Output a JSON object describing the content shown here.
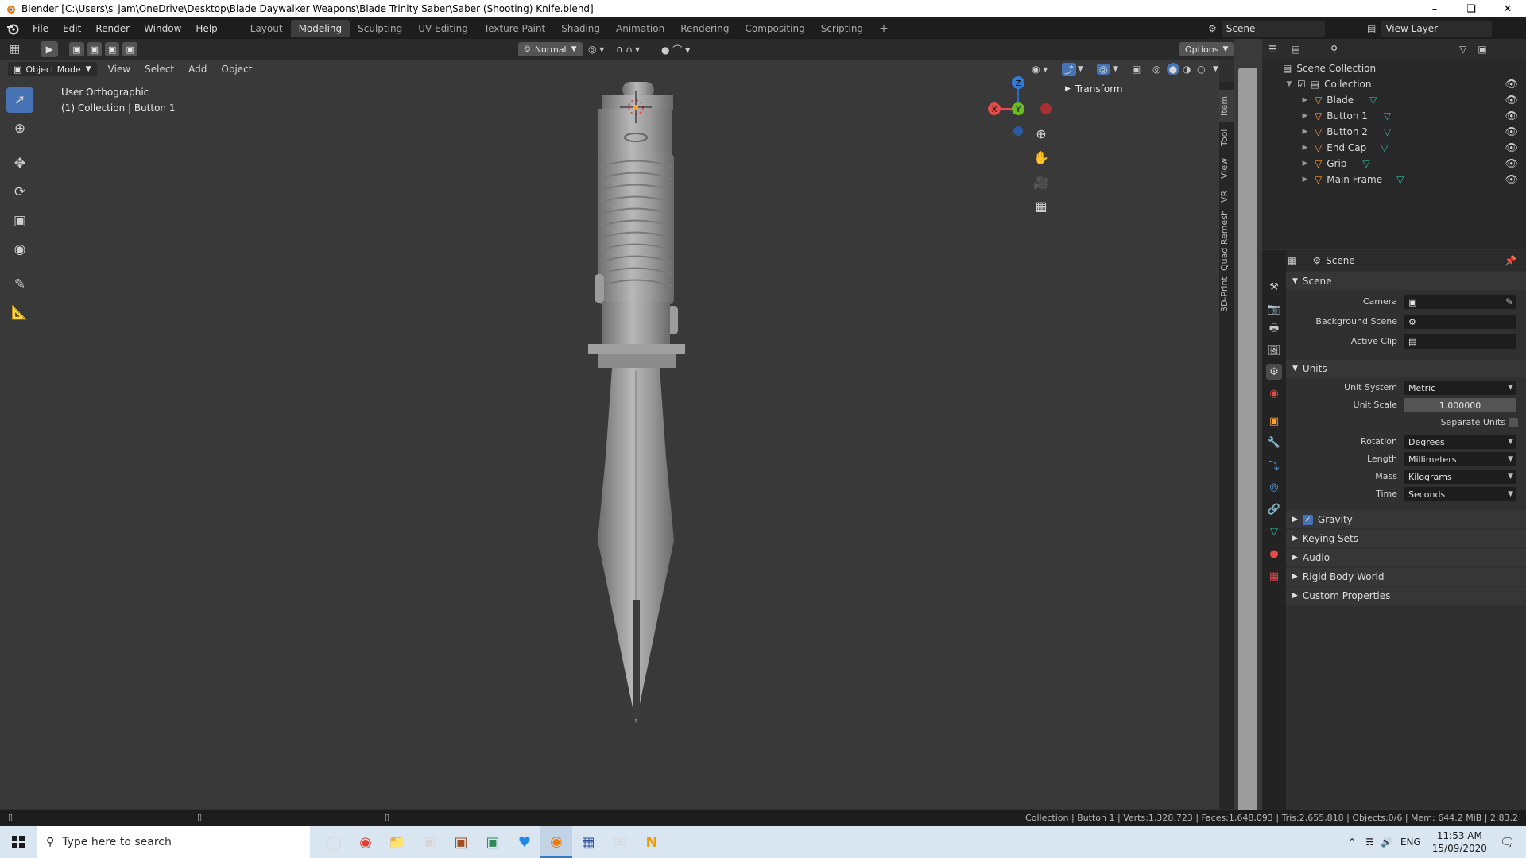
{
  "window": {
    "title": "Blender [C:\\Users\\s_jam\\OneDrive\\Desktop\\Blade Daywalker Weapons\\Blade Trinity Saber\\Saber (Shooting) Knife.blend]"
  },
  "menu": [
    "File",
    "Edit",
    "Render",
    "Window",
    "Help"
  ],
  "workspaces": [
    "Layout",
    "Modeling",
    "Sculpting",
    "UV Editing",
    "Texture Paint",
    "Shading",
    "Animation",
    "Rendering",
    "Compositing",
    "Scripting"
  ],
  "active_workspace": "Modeling",
  "scene_selector": "Scene",
  "view_layer_selector": "View Layer",
  "viewport": {
    "orientation_label": "Normal",
    "options_label": "Options",
    "mode_label": "Object Mode",
    "header_menus": [
      "View",
      "Select",
      "Add",
      "Object"
    ],
    "view_name": "User Orthographic",
    "view_sub": "(1) Collection | Button 1",
    "transform_panel": "Transform",
    "npanel_tabs": [
      "Item",
      "Tool",
      "View",
      "VR",
      "Quad Remesh",
      "3D-Print"
    ],
    "gizmo": {
      "z": "Z",
      "y": "Y",
      "x": "X"
    }
  },
  "outliner": {
    "root": "Scene Collection",
    "collection": "Collection",
    "objects": [
      "Blade",
      "Button 1",
      "Button 2",
      "End Cap",
      "Grip",
      "Main Frame"
    ]
  },
  "properties": {
    "header": "Scene",
    "scene_section": "Scene",
    "camera_label": "Camera",
    "background_scene_label": "Background Scene",
    "active_clip_label": "Active Clip",
    "units_section": "Units",
    "unit_system_label": "Unit System",
    "unit_system_value": "Metric",
    "unit_scale_label": "Unit Scale",
    "unit_scale_value": "1.000000",
    "separate_units_label": "Separate Units",
    "rotation_label": "Rotation",
    "rotation_value": "Degrees",
    "length_label": "Length",
    "length_value": "Millimeters",
    "mass_label": "Mass",
    "mass_value": "Kilograms",
    "time_label": "Time",
    "time_value": "Seconds",
    "gravity_label": "Gravity",
    "collapsed_sections": [
      "Keying Sets",
      "Audio",
      "Rigid Body World",
      "Custom Properties"
    ]
  },
  "status": {
    "text": "Collection | Button 1 | Verts:1,328,723 | Faces:1,648,093 | Tris:2,655,818 | Objects:0/6 | Mem: 644.2 MiB | 2.83.2"
  },
  "taskbar": {
    "search_placeholder": "Type here to search",
    "lang": "ENG",
    "time": "11:53 AM",
    "date": "15/09/2020"
  },
  "colors": {
    "accent": "#4772b3",
    "selected_text": "#ff9f2e"
  }
}
